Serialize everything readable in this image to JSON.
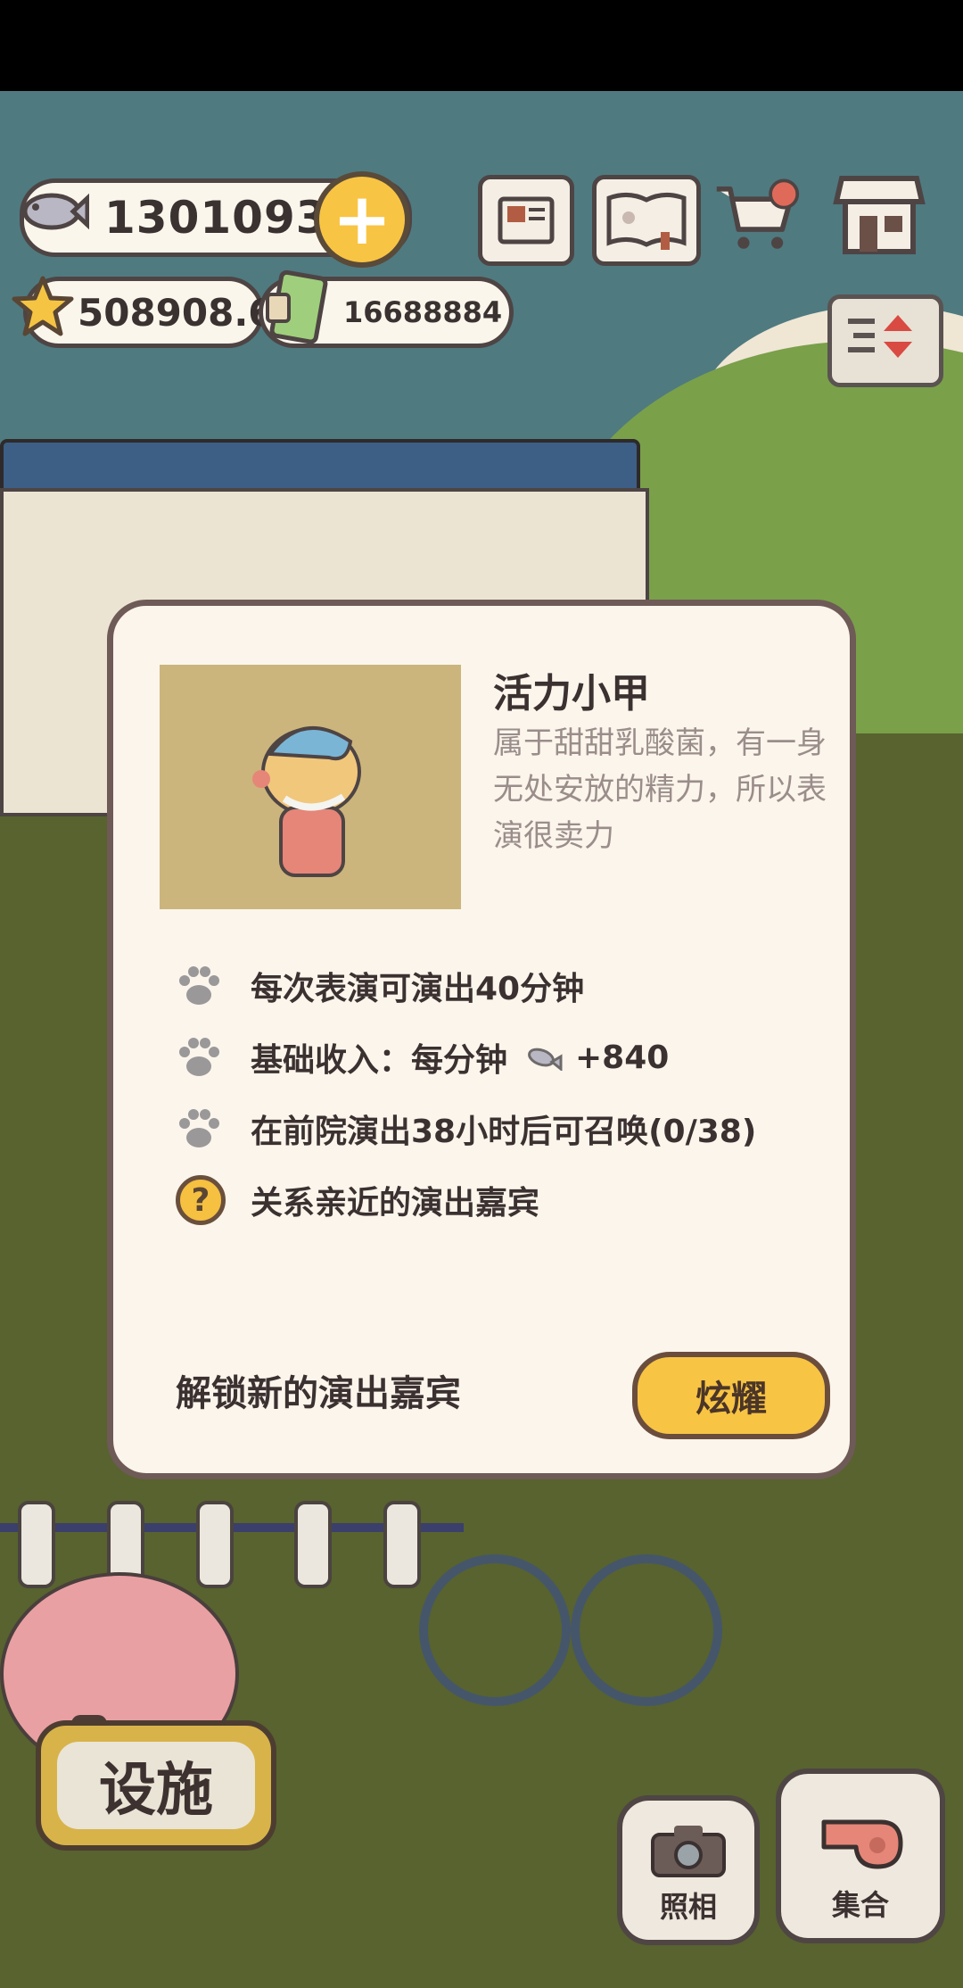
{
  "currency": {
    "fish": "13010933",
    "stars": "508908.6",
    "cash": "16688884"
  },
  "hud_icons": [
    "newspaper-icon",
    "paw-book-icon",
    "cart-icon",
    "shop-icon",
    "sort-toggle-icon"
  ],
  "modal": {
    "name": "活力小甲",
    "description": "属于甜甜乳酸菌，有一身无处安放的精力，所以表演很卖力",
    "rows": [
      {
        "text": "每次表演可演出40分钟"
      },
      {
        "prefix": "基础收入：每分钟",
        "suffix": "+840"
      },
      {
        "text": "在前院演出38小时后可召唤(0/38)"
      },
      {
        "text": "关系亲近的演出嘉宾"
      }
    ],
    "unlock_label": "解锁新的演出嘉宾",
    "flaunt_button": "炫耀"
  },
  "bottom": {
    "facility": "设施",
    "photo": "照相",
    "gather": "集合"
  },
  "colors": {
    "accent_yellow": "#f8c443",
    "outline": "#4e4444",
    "panel": "#fbf5ec"
  }
}
